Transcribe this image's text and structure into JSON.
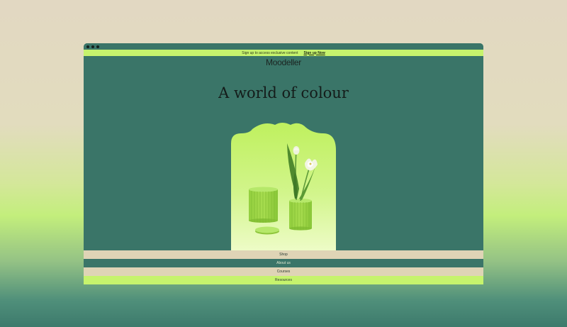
{
  "announcement": {
    "text": "Sign up to access exclusive content",
    "cta": "Sign up Now"
  },
  "brand": {
    "logo": "Moodeller"
  },
  "hero": {
    "heading": "A world of colour"
  },
  "nav": [
    {
      "label": "Shop"
    },
    {
      "label": "About us"
    },
    {
      "label": "Courses"
    },
    {
      "label": "Resources"
    }
  ],
  "colors": {
    "window_bg": "#3a7568",
    "lime_accent": "#c6f36d",
    "beige": "#dfd4b6",
    "arch_green": "#c2f065"
  }
}
